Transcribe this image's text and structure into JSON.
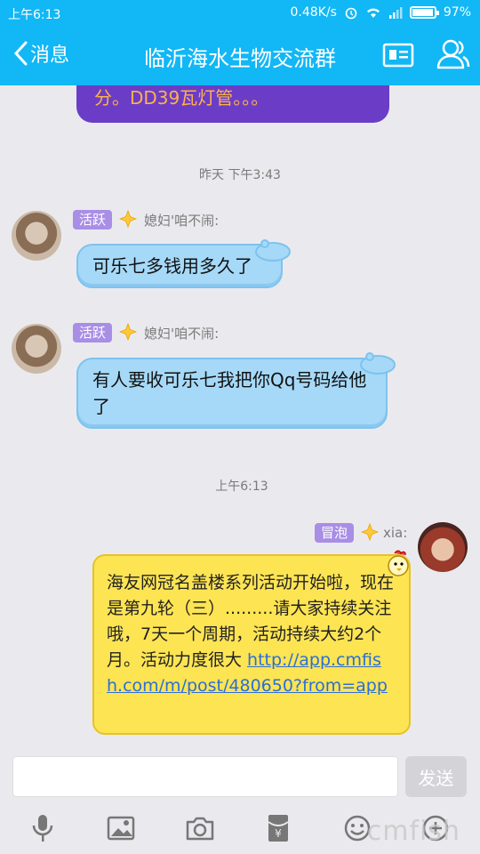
{
  "status_bar": {
    "time": "上午6:13",
    "network_speed": "0.48K/s",
    "battery": "97%",
    "battery_level": 0.97
  },
  "header": {
    "back_label": "消息",
    "title": "临沂海水生物交流群"
  },
  "messages": {
    "partial_text": "分。DD39瓦灯管。。。",
    "ts1": "昨天 下午3:43",
    "m1": {
      "badge": "活跃",
      "sender": "媳妇'咱不闹:",
      "text": "可乐七多钱用多久了"
    },
    "m2": {
      "badge": "活跃",
      "sender": "媳妇'咱不闹:",
      "text": "有人要收可乐七我把你Qq号码给他了"
    },
    "ts2": "上午6:13",
    "m3": {
      "badge": "冒泡",
      "sender": "xia:",
      "text": "海友网冠名盖楼系列活动开始啦，现在是第九轮（三）.........请大家持续关注哦，7天一个周期，活动持续大约2个月。活动力度很大 ",
      "link": "http://app.cmfish.com/m/post/480650?from=app"
    }
  },
  "input": {
    "send_label": "发送"
  },
  "watermark": "cmfish",
  "colors": {
    "accent": "#12b7f5",
    "bubble_blue": "#a6d9f7",
    "bubble_yellow": "#fde453",
    "badge_purple": "#a98ee6"
  },
  "icons": [
    "back-chevron-icon",
    "profile-card-icon",
    "group-members-icon",
    "star-icon",
    "microphone-icon",
    "image-icon",
    "camera-icon",
    "red-packet-icon",
    "emoji-icon",
    "plus-icon"
  ]
}
